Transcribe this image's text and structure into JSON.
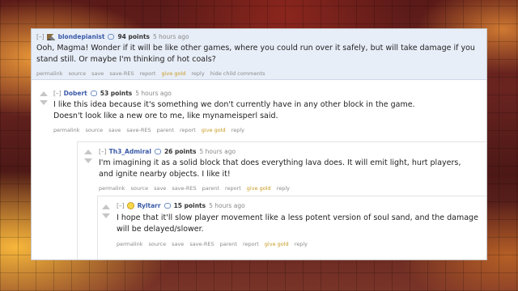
{
  "comments": [
    {
      "toggle": "[–]",
      "author": "blondepianist",
      "points": "94 points",
      "time": "5 hours ago",
      "text": "Ooh, Magma! Wonder if it will be like other games, where you could run over it safely, but will take damage if you stand still. Or maybe I'm thinking of hot coals?",
      "links": [
        "permalink",
        "source",
        "save",
        "save-RES",
        "report",
        "give gold",
        "reply",
        "hide child comments"
      ]
    },
    {
      "toggle": "[–]",
      "author": "Dobert",
      "points": "53 points",
      "time": "5 hours ago",
      "text": "I like this idea because it's something we don't currently have in any other block in the game. Doesn't look like a new ore to me, like mynameisperl said.",
      "links": [
        "permalink",
        "source",
        "save",
        "save-RES",
        "parent",
        "report",
        "give gold",
        "reply"
      ]
    },
    {
      "toggle": "[–]",
      "author": "Th3_Admiral",
      "points": "26 points",
      "time": "5 hours ago",
      "text": "I'm imagining it as a solid block that does everything lava does. It will emit light, hurt players, and ignite nearby objects. I like it!",
      "links": [
        "permalink",
        "source",
        "save",
        "save-RES",
        "parent",
        "report",
        "give gold",
        "reply"
      ]
    },
    {
      "toggle": "[–]",
      "author": "Ryltarr",
      "points": "15 points",
      "time": "5 hours ago",
      "text": "I hope that it'll slow player movement like a less potent version of soul sand, and the damage will be delayed/slower.",
      "links": [
        "permalink",
        "source",
        "save",
        "save-RES",
        "parent",
        "report",
        "give gold",
        "reply"
      ]
    }
  ]
}
